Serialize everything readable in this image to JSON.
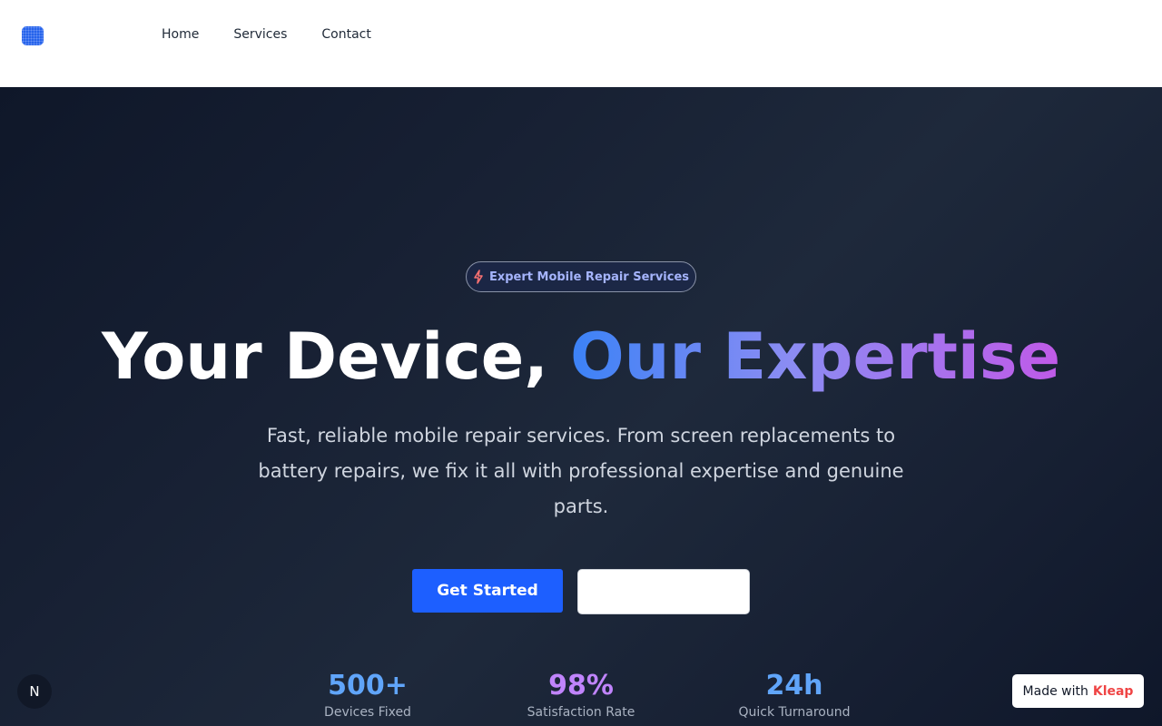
{
  "header": {
    "logo_icon": "logo-icon",
    "nav": [
      {
        "label": "Home"
      },
      {
        "label": "Services"
      },
      {
        "label": "Contact"
      }
    ]
  },
  "hero": {
    "badge": {
      "icon": "lightning-bolt-icon",
      "text": "Expert Mobile Repair Services"
    },
    "headline_plain": "Your Device, ",
    "headline_gradient": "Our Expertise",
    "subtitle": "Fast, reliable mobile repair services. From screen replacements to battery repairs, we fix it all with professional expertise and genuine parts.",
    "primary_button": "Get Started",
    "secondary_button": "",
    "stats": [
      {
        "value": "500+",
        "label": "Devices Fixed",
        "color": "#60a5fa"
      },
      {
        "value": "98%",
        "label": "Satisfaction Rate",
        "color": "#c084fc"
      },
      {
        "value": "24h",
        "label": "Quick Turnaround",
        "color": "#60a5fa"
      }
    ]
  },
  "corner_badge": {
    "text": "N"
  },
  "made_with": {
    "prefix": "Made with",
    "brand": "Kleap"
  },
  "colors": {
    "primary": "#1d5fff",
    "hero_bg": "#172033",
    "gradient_start": "#3b82f6",
    "gradient_end": "#c05ae8",
    "brand_red": "#ef4444"
  }
}
